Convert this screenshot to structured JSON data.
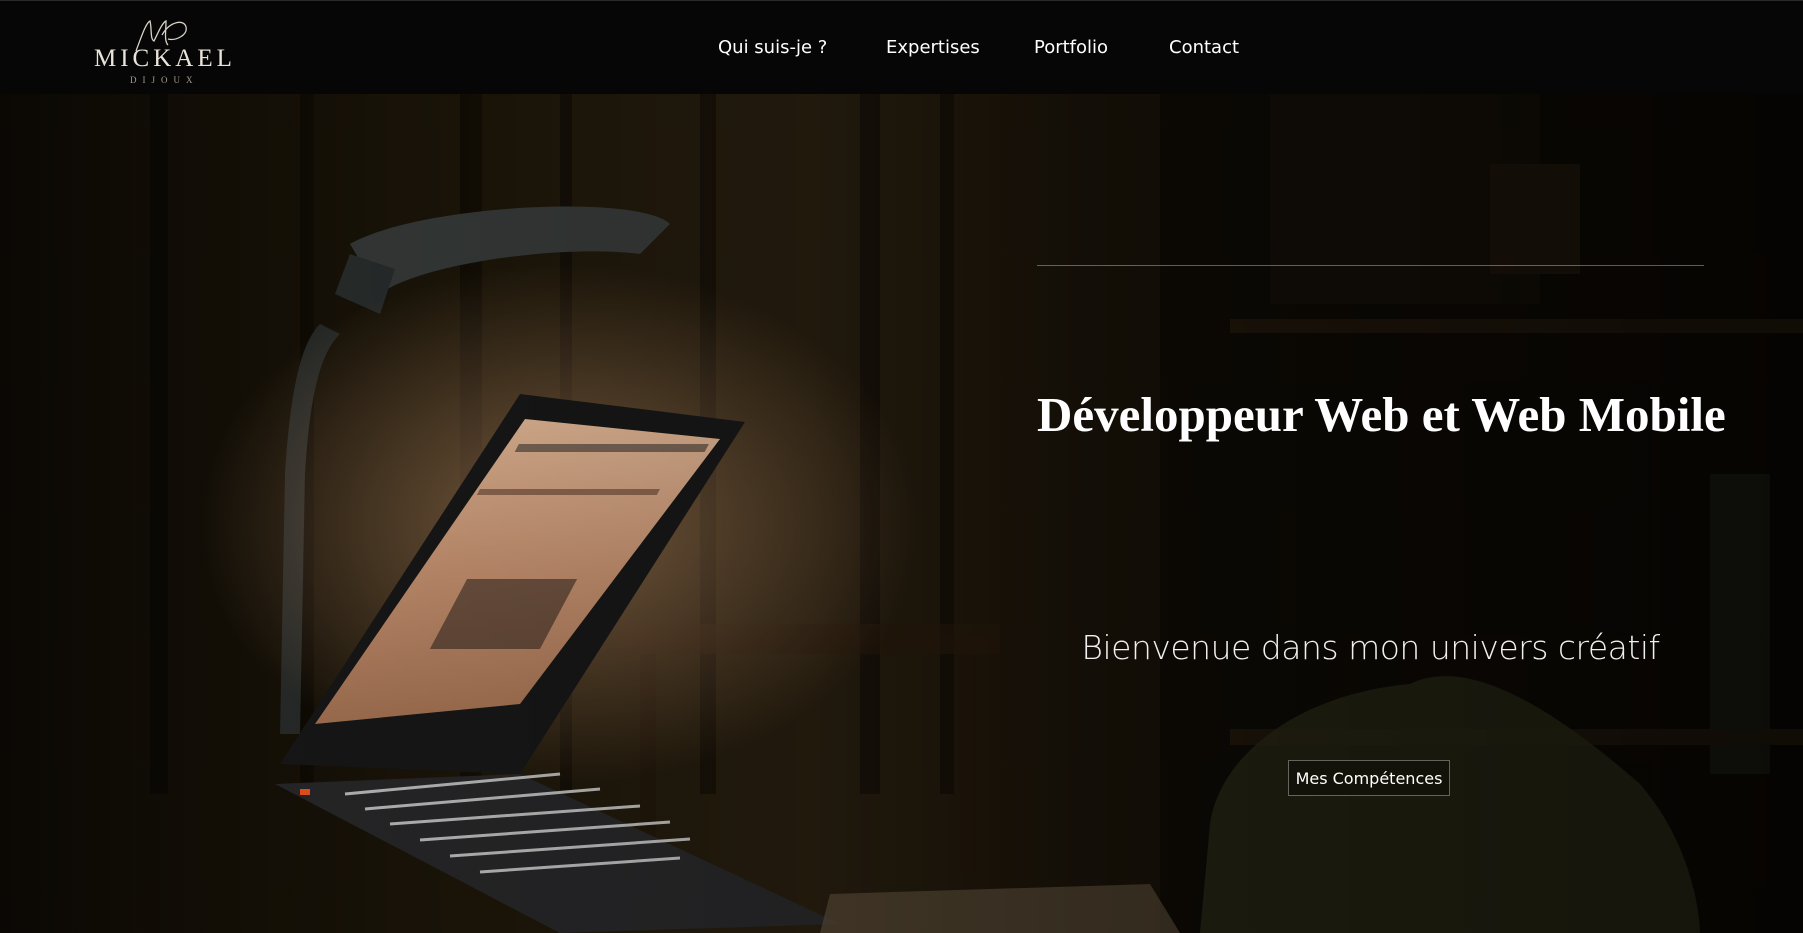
{
  "brand": {
    "name": "MICKAEL",
    "surname": "DIJOUX",
    "monogram": "MD"
  },
  "nav": {
    "items": [
      {
        "label": "Qui suis-je ?"
      },
      {
        "label": "Expertises"
      },
      {
        "label": "Portfolio"
      },
      {
        "label": "Contact"
      }
    ]
  },
  "hero": {
    "title": "Développeur Web et Web Mobile",
    "subtitle": "Bienvenue dans mon univers créatif",
    "cta_label": "Mes Compétences",
    "background": "dark-room-laptop-photo"
  },
  "colors": {
    "header_bg": "#060606",
    "text": "#ffffff",
    "logo": "#e9e4da"
  }
}
